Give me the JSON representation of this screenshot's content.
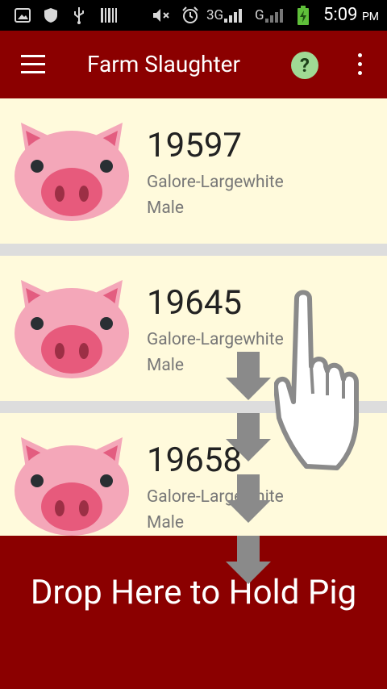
{
  "status_bar": {
    "time": "5:09",
    "ampm": "PM",
    "network_1": "3G",
    "network_2": "G"
  },
  "app_bar": {
    "title": "Farm Slaughter",
    "help_label": "?"
  },
  "pigs": [
    {
      "id": "19597",
      "breed": "Galore-Largewhite",
      "sex": "Male"
    },
    {
      "id": "19645",
      "breed": "Galore-Largewhite",
      "sex": "Male"
    },
    {
      "id": "19658",
      "breed": "Galore-Largewhite",
      "sex": "Male"
    }
  ],
  "drop_zone": {
    "label": "Drop Here to Hold Pig"
  },
  "colors": {
    "primary": "#8b0000",
    "card_bg": "#fffadc",
    "divider": "#dddddd",
    "help_bg": "#a0d994"
  }
}
